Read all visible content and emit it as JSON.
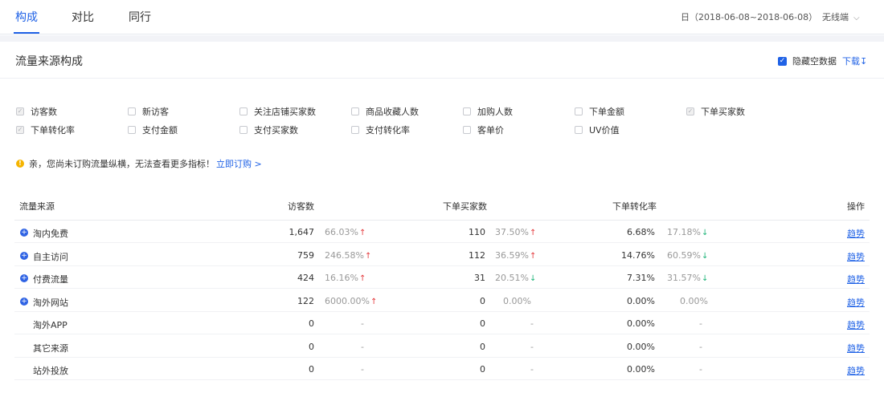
{
  "tabs": [
    {
      "label": "构成",
      "active": true
    },
    {
      "label": "对比",
      "active": false
    },
    {
      "label": "同行",
      "active": false
    }
  ],
  "date_range": "日（2018-06-08~2018-06-08）",
  "device": "无线端",
  "panel_title": "流量来源构成",
  "hide_empty_label": "隐藏空数据",
  "download_label": "下载",
  "metrics": [
    {
      "label": "访客数",
      "checked": true
    },
    {
      "label": "新访客",
      "checked": false
    },
    {
      "label": "关注店铺买家数",
      "checked": false
    },
    {
      "label": "商品收藏人数",
      "checked": false
    },
    {
      "label": "加购人数",
      "checked": false
    },
    {
      "label": "下单金额",
      "checked": false
    },
    {
      "label": "下单买家数",
      "checked": true
    },
    {
      "label": "下单转化率",
      "checked": true
    },
    {
      "label": "支付金额",
      "checked": false
    },
    {
      "label": "支付买家数",
      "checked": false
    },
    {
      "label": "支付转化率",
      "checked": false
    },
    {
      "label": "客单价",
      "checked": false
    },
    {
      "label": "UV价值",
      "checked": false
    }
  ],
  "notice_text": "亲，您尚未订购流量纵横，无法查看更多指标！",
  "notice_link": "立即订购 >",
  "columns": [
    "流量来源",
    "访客数",
    "下单买家数",
    "下单转化率",
    "操作"
  ],
  "rows": [
    {
      "source": "淘内免费",
      "expandable": true,
      "visitors": "1,647",
      "visitors_pct": "66.03%",
      "visitors_dir": "up",
      "buyers": "110",
      "buyers_pct": "37.50%",
      "buyers_dir": "up",
      "rate": "6.68%",
      "rate_pct": "17.18%",
      "rate_dir": "down",
      "action": "趋势"
    },
    {
      "source": "自主访问",
      "expandable": true,
      "visitors": "759",
      "visitors_pct": "246.58%",
      "visitors_dir": "up",
      "buyers": "112",
      "buyers_pct": "36.59%",
      "buyers_dir": "up",
      "rate": "14.76%",
      "rate_pct": "60.59%",
      "rate_dir": "down",
      "action": "趋势"
    },
    {
      "source": "付费流量",
      "expandable": true,
      "visitors": "424",
      "visitors_pct": "16.16%",
      "visitors_dir": "up",
      "buyers": "31",
      "buyers_pct": "20.51%",
      "buyers_dir": "down",
      "rate": "7.31%",
      "rate_pct": "31.57%",
      "rate_dir": "down",
      "action": "趋势"
    },
    {
      "source": "淘外网站",
      "expandable": true,
      "visitors": "122",
      "visitors_pct": "6000.00%",
      "visitors_dir": "up",
      "buyers": "0",
      "buyers_pct": "0.00%",
      "buyers_dir": "",
      "rate": "0.00%",
      "rate_pct": "0.00%",
      "rate_dir": "",
      "action": "趋势"
    },
    {
      "source": "淘外APP",
      "expandable": false,
      "visitors": "0",
      "visitors_pct": "-",
      "visitors_dir": "",
      "buyers": "0",
      "buyers_pct": "-",
      "buyers_dir": "",
      "rate": "0.00%",
      "rate_pct": "-",
      "rate_dir": "",
      "action": "趋势"
    },
    {
      "source": "其它来源",
      "expandable": false,
      "visitors": "0",
      "visitors_pct": "-",
      "visitors_dir": "",
      "buyers": "0",
      "buyers_pct": "-",
      "buyers_dir": "",
      "rate": "0.00%",
      "rate_pct": "-",
      "rate_dir": "",
      "action": "趋势"
    },
    {
      "source": "站外投放",
      "expandable": false,
      "visitors": "0",
      "visitors_pct": "-",
      "visitors_dir": "",
      "buyers": "0",
      "buyers_pct": "-",
      "buyers_dir": "",
      "rate": "0.00%",
      "rate_pct": "-",
      "rate_dir": "",
      "action": "趋势"
    }
  ],
  "colors": {
    "accent": "#2062e6",
    "up": "#e4393c",
    "down": "#1fb57a"
  },
  "icons": {
    "expand": "plus-circle-icon",
    "up": "arrow-up-icon",
    "down": "arrow-down-icon",
    "warning": "warning-icon",
    "chevron": "chevron-down-icon"
  }
}
